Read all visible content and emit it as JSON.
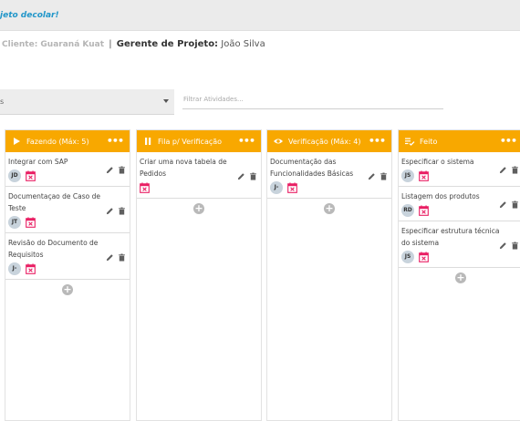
{
  "topbar": {
    "text": "jeto decolar!"
  },
  "project": {
    "client": "Cliente: Guaraná Kuat",
    "sep": "|",
    "manager_label": "Gerente de Projeto:",
    "manager_name": "João Silva"
  },
  "filter_select": {
    "value": "s"
  },
  "filter_input": {
    "placeholder": "Filtrar Atividades..."
  },
  "columns": [
    {
      "title": "Fazendo (Máx: 5)",
      "icon": "play-icon",
      "menu": "•••",
      "cards": [
        {
          "title": "Integrar com SAP",
          "avatar": "JD"
        },
        {
          "title": "Documentaçao de Caso de Teste",
          "avatar": "JT"
        },
        {
          "title": "Revisão do Documento de Requisitos",
          "avatar": "J-"
        }
      ]
    },
    {
      "title": "Fila p/ Verificação",
      "icon": "pause-icon",
      "menu": "•••",
      "cards": [
        {
          "title": "Criar uma nova tabela de Pedidos",
          "avatar": ""
        }
      ]
    },
    {
      "title": "Verificação (Máx: 4)",
      "icon": "eye-icon",
      "menu": "•••",
      "cards": [
        {
          "title": "Documentação das Funcionalidades Básicas",
          "avatar": "J-"
        }
      ]
    },
    {
      "title": "Feito",
      "icon": "checklist-icon",
      "menu": "•••",
      "cards": [
        {
          "title": "Especificar o sistema",
          "avatar": "JS"
        },
        {
          "title": "Listagem dos produtos",
          "avatar": "RD"
        },
        {
          "title": "Especificar estrutura técnica do sistema",
          "avatar": "JS"
        }
      ]
    }
  ],
  "add_label": "+",
  "colors": {
    "header": "#f8a800",
    "calendar": "#e91e63",
    "avatar": "#c8d3dc",
    "topbar_text": "#2196c9"
  }
}
